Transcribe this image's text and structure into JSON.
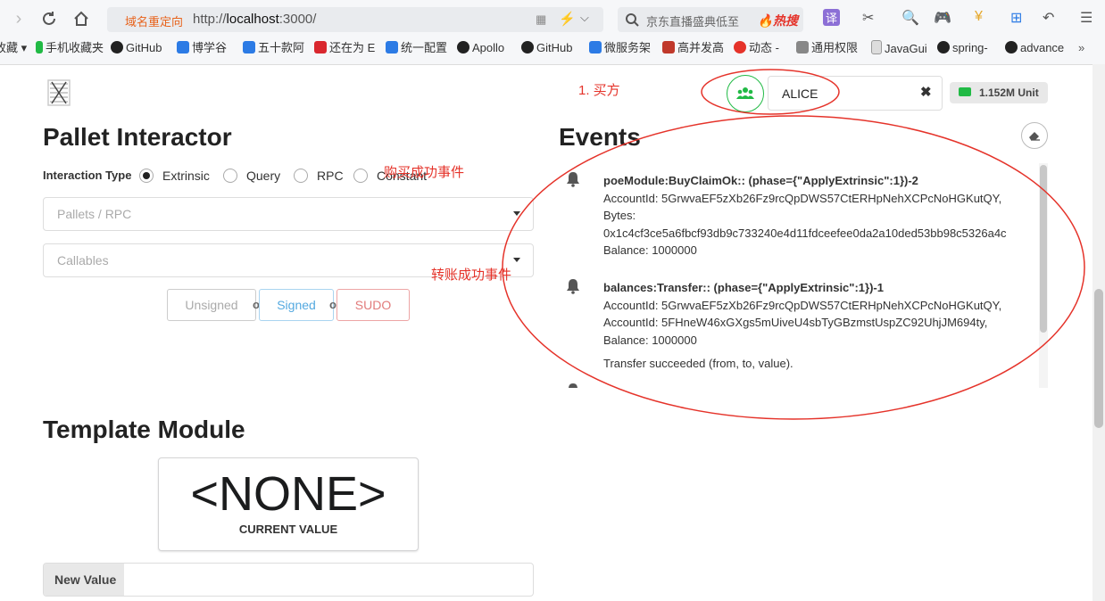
{
  "browser": {
    "url_prefix": "http://",
    "url_host": "localhost",
    "url_port": ":3000/",
    "redirect_label": "域名重定向",
    "search_text": "京东直播盛典低至",
    "search_hot": "热搜",
    "bookmarks": [
      "收藏",
      "手机收藏夹",
      "GitHub",
      "博学谷",
      "五十款阿",
      "还在为 E",
      "统一配置",
      "Apollo",
      "GitHub",
      "微服务架",
      "高并发高",
      "动态 -",
      "通用权限",
      "JavaGui",
      "spring-",
      "advance"
    ]
  },
  "app": {
    "account_name": "ALICE",
    "balance": "1.152M Unit"
  },
  "pallet": {
    "title": "Pallet Interactor",
    "interaction_label": "Interaction Type",
    "options": [
      "Extrinsic",
      "Query",
      "RPC",
      "Constant"
    ],
    "pallet_placeholder": "Pallets / RPC",
    "callable_placeholder": "Callables",
    "btn_unsigned": "Unsigned",
    "btn_signed": "Signed",
    "btn_sudo": "SUDO",
    "or": "or"
  },
  "events": {
    "title": "Events",
    "items": [
      {
        "title": "poeModule:BuyClaimOk:: (phase={\"ApplyExtrinsic\":1})-2",
        "lines": [
          "AccountId: 5GrwvaEF5zXb26Fz9rcQpDWS57CtERHpNehXCPcNoHGKutQY,",
          "Bytes:",
          "0x1c4cf3ce5a6fbcf93db9c733240e4d11fdceefee0da2a10ded53bb98c5326a4c",
          "Balance: 1000000"
        ]
      },
      {
        "title": "balances:Transfer:: (phase={\"ApplyExtrinsic\":1})-1",
        "lines": [
          "AccountId: 5GrwvaEF5zXb26Fz9rcQpDWS57CtERHpNehXCPcNoHGKutQY,",
          "AccountId: 5FHneW46xGXgs5mUiveU4sbTyGBzmstUspZC92UhjJM694ty,",
          "Balance: 1000000"
        ],
        "desc": "Transfer succeeded (from, to, value)."
      }
    ]
  },
  "template": {
    "title": "Template Module",
    "value": "<NONE>",
    "value_label": "CURRENT VALUE",
    "new_value_label": "New Value"
  },
  "annotations": {
    "buyer": "1. 买方",
    "buy_event": "购买成功事件",
    "transfer_event": "转账成功事件"
  },
  "colors": {
    "accent_green": "#21ba45",
    "signed_blue": "#54a9e0",
    "sudo_red": "#db5c5c",
    "annotation_red": "#e5332a"
  }
}
